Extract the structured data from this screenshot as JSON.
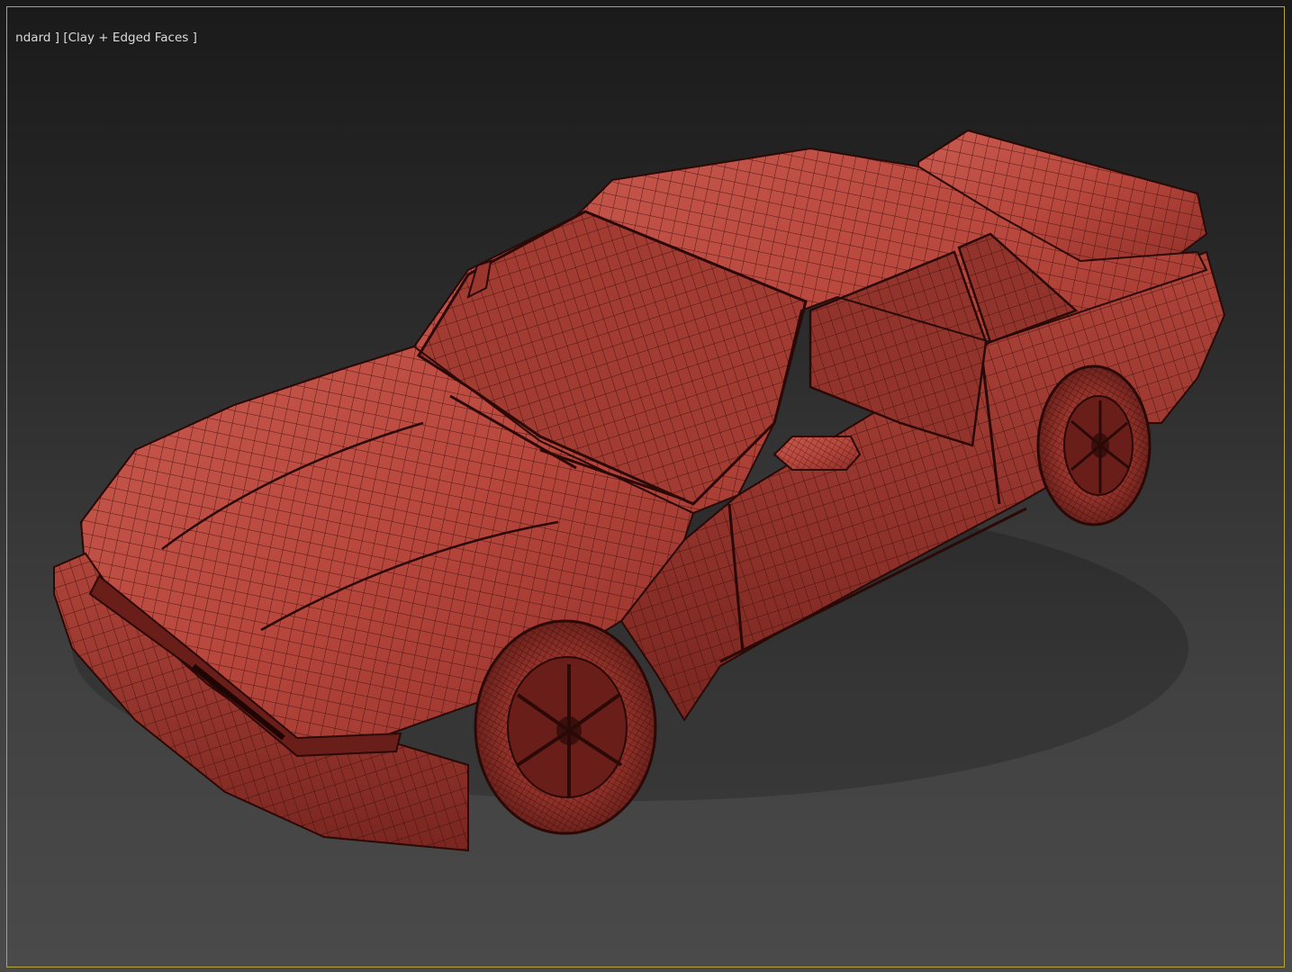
{
  "viewport": {
    "label_shading_menu": "ndard ]",
    "label_display_mode_menu": "[Clay + Edged Faces ]",
    "colors": {
      "border": "#b9a63a",
      "clay": "#b8473d",
      "wire": "#3a0f0c"
    }
  },
  "scene": {
    "object": "car-model"
  }
}
